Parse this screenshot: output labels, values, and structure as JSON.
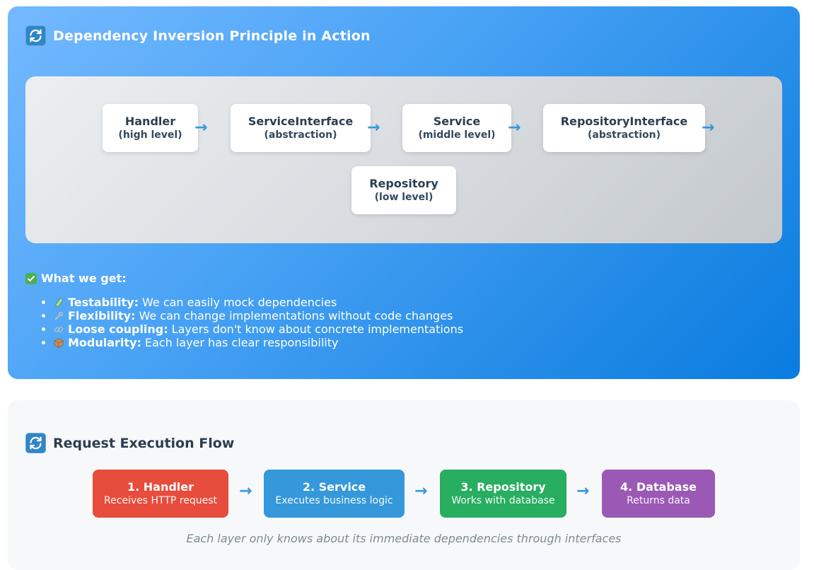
{
  "dip": {
    "title": "Dependency Inversion Principle in Action",
    "layers": [
      {
        "name": "Handler",
        "level": "(high level)"
      },
      {
        "name": "ServiceInterface",
        "level": "(abstraction)"
      },
      {
        "name": "Service",
        "level": "(middle level)"
      },
      {
        "name": "RepositoryInterface",
        "level": "(abstraction)"
      },
      {
        "name": "Repository",
        "level": "(low level)"
      }
    ],
    "arrow": "→",
    "benefits_heading": "What we get:",
    "benefits": [
      {
        "icon": "test-tube-icon",
        "label": "Testability:",
        "text": "We can easily mock dependencies"
      },
      {
        "icon": "wrench-icon",
        "label": "Flexibility:",
        "text": "We can change implementations without code changes"
      },
      {
        "icon": "link-icon",
        "label": "Loose coupling:",
        "text": "Layers don't know about concrete implementations"
      },
      {
        "icon": "package-icon",
        "label": "Modularity:",
        "text": "Each layer has clear responsibility"
      }
    ]
  },
  "flow": {
    "title": "Request Execution Flow",
    "steps": [
      {
        "name": "1. Handler",
        "desc": "Receives HTTP request",
        "color": "#e74c3c"
      },
      {
        "name": "2. Service",
        "desc": "Executes business logic",
        "color": "#3498db"
      },
      {
        "name": "3. Repository",
        "desc": "Works with database",
        "color": "#27ae60"
      },
      {
        "name": "4. Database",
        "desc": "Returns data",
        "color": "#9b59b6"
      }
    ],
    "note": "Each layer only knows about its immediate dependencies through interfaces"
  }
}
